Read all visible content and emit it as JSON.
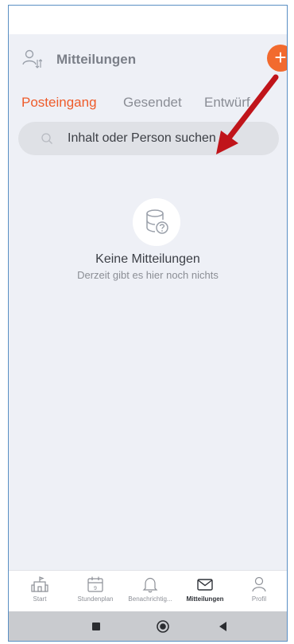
{
  "header": {
    "title": "Mitteilungen",
    "add_label": "+"
  },
  "tabs": [
    {
      "label": "Posteingang",
      "active": true
    },
    {
      "label": "Gesendet",
      "active": false
    },
    {
      "label": "Entwürf",
      "active": false
    }
  ],
  "search": {
    "placeholder": "Inhalt oder Person suchen"
  },
  "empty_state": {
    "title": "Keine Mitteilungen",
    "subtitle": "Derzeit gibt es hier noch nichts"
  },
  "bottom_nav": [
    {
      "label": "Start",
      "icon": "school-icon"
    },
    {
      "label": "Stundenplan",
      "icon": "calendar-icon",
      "day": "9"
    },
    {
      "label": "Benachrichtig...",
      "icon": "bell-icon"
    },
    {
      "label": "Mitteilungen",
      "icon": "envelope-icon",
      "active": true
    },
    {
      "label": "Profil",
      "icon": "person-icon"
    }
  ],
  "colors": {
    "accent": "#ee5b2a",
    "add_button": "#f26a2e",
    "annotation_arrow": "#c0141a"
  }
}
